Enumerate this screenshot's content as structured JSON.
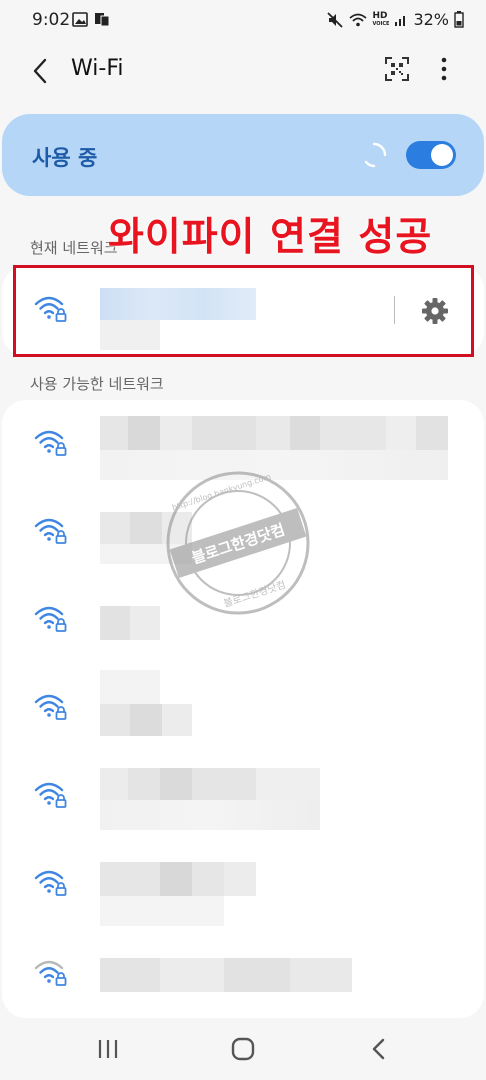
{
  "status_bar": {
    "time": "9:02",
    "battery": "32%",
    "hd_label": "HD",
    "voice_label": "VOICE"
  },
  "app_bar": {
    "title": "Wi-Fi"
  },
  "toggle": {
    "label": "사용 중",
    "on": true
  },
  "annotation": {
    "text": "와이파이 연결 성공"
  },
  "sections": {
    "current": "현재 네트워크",
    "available": "사용 가능한 네트워크"
  },
  "watermark": {
    "center_text": "블로그한경닷컴",
    "ring_top": "http://blog.hankyung.com",
    "ring_bottom": "블로그한경닷컴"
  },
  "colors": {
    "accent": "#2b7ee0",
    "toggle_card": "#b5d6f6",
    "annotation_red": "#e8141f",
    "wifi_icon": "#3f86e2"
  }
}
